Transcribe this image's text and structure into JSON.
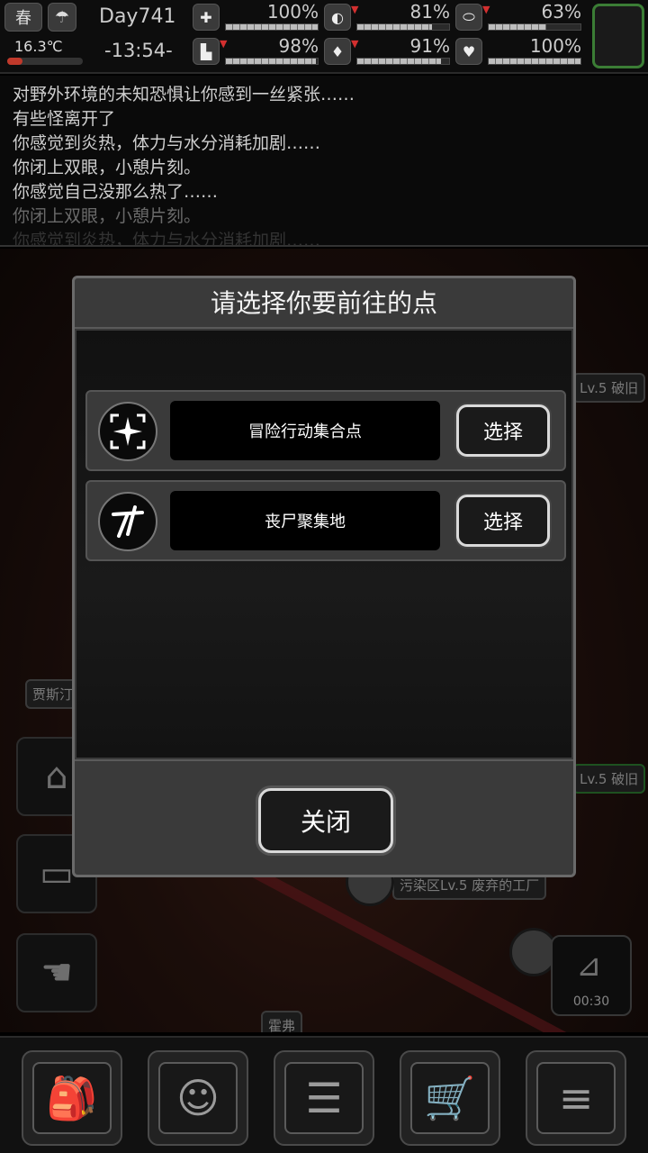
{
  "status": {
    "season": "春",
    "temperature": "16.3℃",
    "temperature_level": 0.2,
    "day": "Day741",
    "time": "-13:54-",
    "stats": [
      {
        "name": "health-stat",
        "icon": "medkit-icon",
        "glyph": "✚",
        "value": "100%",
        "level": 1.0,
        "dropping": false
      },
      {
        "name": "hunger-stat",
        "icon": "stomach-icon",
        "glyph": "◐",
        "value": "81%",
        "level": 0.81,
        "dropping": true
      },
      {
        "name": "medicine-stat",
        "icon": "pill-icon",
        "glyph": "⬭",
        "value": "63%",
        "level": 0.63,
        "dropping": true
      },
      {
        "name": "stamina-stat",
        "icon": "boot-icon",
        "glyph": "▙",
        "value": "98%",
        "level": 0.98,
        "dropping": true
      },
      {
        "name": "thirst-stat",
        "icon": "water-drop-icon",
        "glyph": "♦",
        "value": "91%",
        "level": 0.91,
        "dropping": true
      },
      {
        "name": "mood-stat",
        "icon": "heart-icon",
        "glyph": "♥",
        "value": "100%",
        "level": 1.0,
        "dropping": false
      }
    ]
  },
  "log": [
    "对野外环境的未知恐惧让你感到一丝紧张……",
    "有些怪离开了",
    "你感觉到炎热，体力与水分消耗加剧……",
    "你闭上双眼，小憩片刻。",
    "你感觉自己没那么热了……",
    "你闭上双眼，小憩片刻。",
    "你感觉到炎热，体力与水分消耗加剧……"
  ],
  "map": {
    "labels": {
      "lvA": "Lv.5 破旧",
      "lvB": "Lv.5 破旧",
      "lvC": "污染区Lv.5 废弃的工厂",
      "jsd": "贾斯汀",
      "huo": "霍弗"
    },
    "timer": "00:30"
  },
  "dialog": {
    "title": "请选择你要前往的点",
    "options": [
      {
        "name": "冒险行动集合点",
        "button": "选择",
        "icon": "compass-burst-icon"
      },
      {
        "name": "丧尸聚集地",
        "button": "选择",
        "icon": "zombie-tag-icon"
      }
    ],
    "close": "关闭"
  },
  "nav": [
    {
      "name": "backpack-button",
      "icon": "backpack-icon",
      "glyph": "🎒"
    },
    {
      "name": "skills-button",
      "icon": "brain-icon",
      "glyph": "☺"
    },
    {
      "name": "journal-button",
      "icon": "notebook-icon",
      "glyph": "☰"
    },
    {
      "name": "shop-button",
      "icon": "cart-icon",
      "glyph": "🛒"
    },
    {
      "name": "menu-button",
      "icon": "menu-list-icon",
      "glyph": "≡"
    }
  ]
}
